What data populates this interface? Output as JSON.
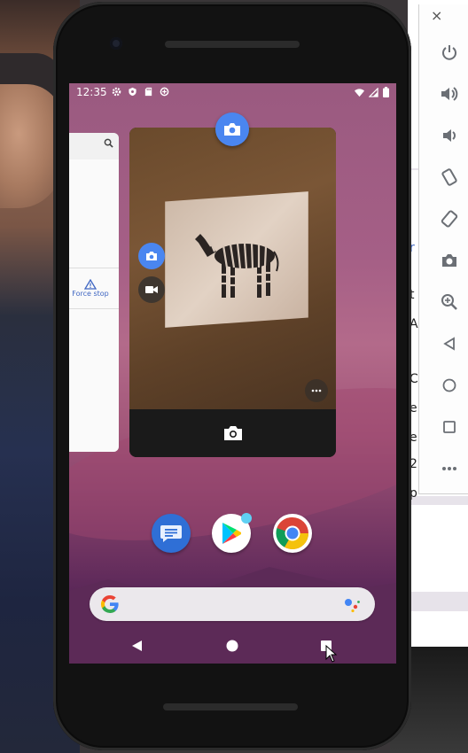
{
  "status_bar": {
    "time": "12:35",
    "left_icons": [
      "settings-icon",
      "shield-icon",
      "sd-card-icon",
      "data-saver-icon"
    ],
    "right_icons": [
      "wifi-icon",
      "signal-icon",
      "battery-icon"
    ]
  },
  "recents": {
    "left_card": {
      "search_icon": "search-icon",
      "force_stop_label": "Force stop"
    },
    "main_card": {
      "app_icon": "camera-icon",
      "viewfinder_subject": "zebra",
      "mode_buttons": [
        "photo-mode-icon",
        "video-mode-icon"
      ],
      "more_icon": "more-horizontal-icon",
      "shutter_icon": "camera-shutter-icon"
    }
  },
  "dock": {
    "apps": [
      "Messages",
      "Play Store",
      "Chrome"
    ]
  },
  "search_bar": {
    "logo": "google-g-icon",
    "assistant": "assistant-icon"
  },
  "nav_bar": {
    "buttons": [
      "back",
      "home",
      "recents"
    ]
  },
  "emulator_toolbar": {
    "buttons": [
      "power",
      "volume-up",
      "volume-down",
      "rotate-left",
      "rotate-right",
      "screenshot",
      "zoom",
      "back",
      "home",
      "overview",
      "more"
    ]
  },
  "background_fragments": [
    "r",
    "t",
    "A",
    "C",
    "e",
    "e",
    "2",
    "p"
  ],
  "colors": {
    "accent_blue": "#4a86f0",
    "wallpaper": "#a55f86"
  }
}
